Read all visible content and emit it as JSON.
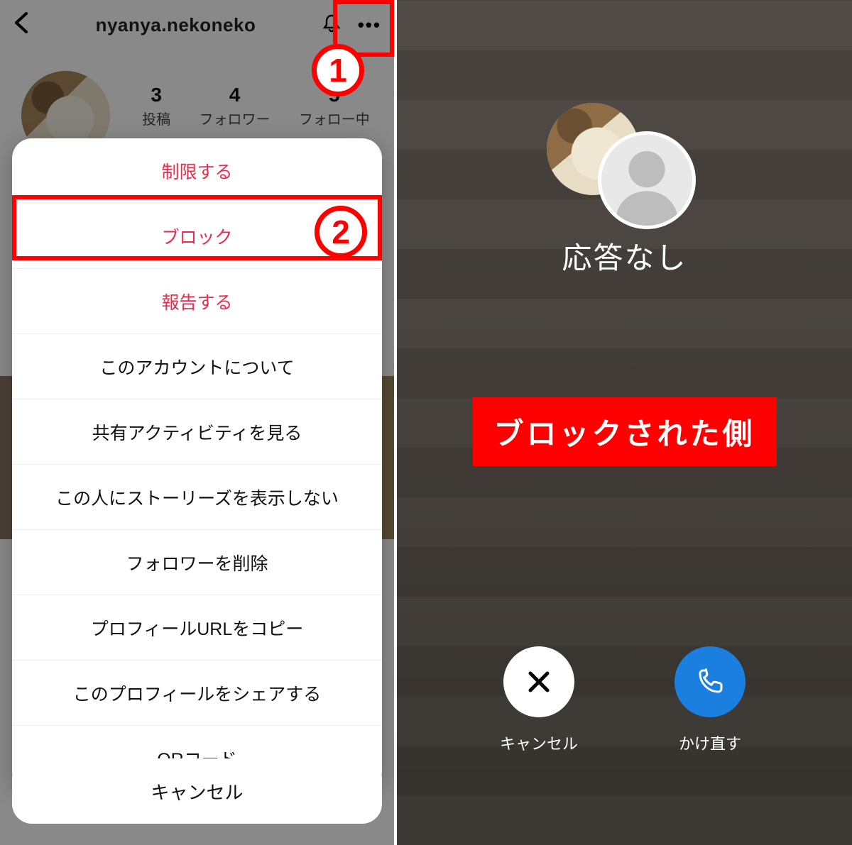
{
  "left": {
    "username": "nyanya.nekoneko",
    "stats": [
      {
        "n": "3",
        "lbl": "投稿"
      },
      {
        "n": "4",
        "lbl": "フォロワー"
      },
      {
        "n": "5",
        "lbl": "フォロー中"
      }
    ],
    "sheet": {
      "restrict": "制限する",
      "block": "ブロック",
      "report": "報告する",
      "about": "このアカウントについて",
      "shared_activity": "共有アクティビティを見る",
      "hide_story": "この人にストーリーズを表示しない",
      "remove_follower": "フォロワーを削除",
      "copy_url": "プロフィールURLをコピー",
      "share_profile": "このプロフィールをシェアする",
      "qr": "QRコード"
    },
    "cancel": "キャンセル",
    "anno1": "1",
    "anno2": "2"
  },
  "right": {
    "status": "応答なし",
    "banner": "ブロックされた側",
    "cancel": "キャンセル",
    "redial": "かけ直す"
  }
}
